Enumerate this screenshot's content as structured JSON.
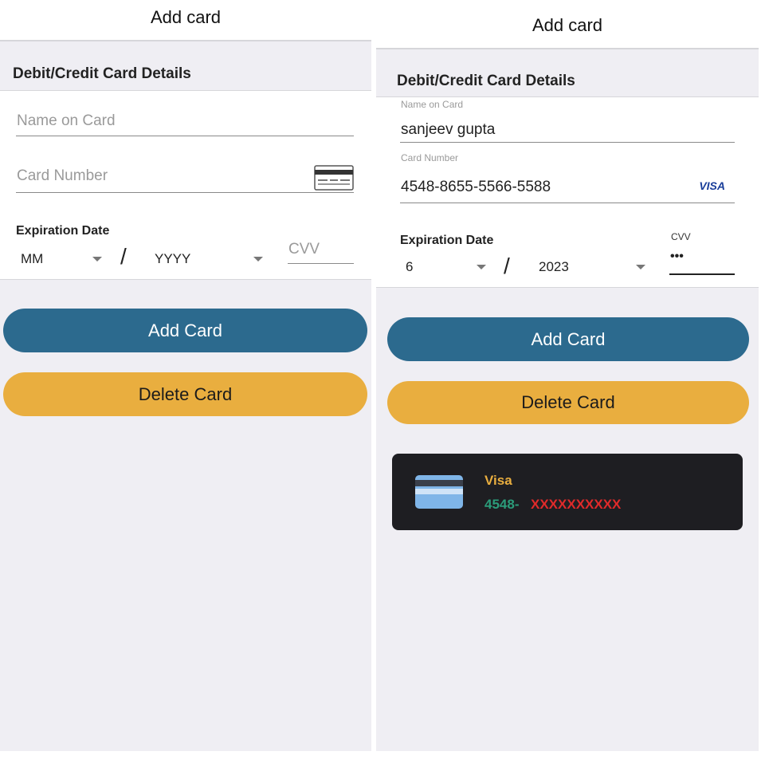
{
  "left": {
    "header": {
      "title": "Add card"
    },
    "section_title": "Debit/Credit Card Details",
    "form": {
      "name_placeholder": "Name on Card",
      "number_placeholder": "Card Number",
      "expiration_label": "Expiration Date",
      "month_value": "MM",
      "year_value": "YYYY",
      "separator": "/",
      "cvv_placeholder": "CVV"
    },
    "buttons": {
      "add_label": "Add Card",
      "delete_label": "Delete Card"
    },
    "icons": {
      "card_icon": "generic-card-icon"
    }
  },
  "right": {
    "header": {
      "title": "Add card"
    },
    "section_title": "Debit/Credit Card Details",
    "form": {
      "name_label": "Name on Card",
      "name_value": "sanjeev gupta",
      "number_label": "Card Number",
      "number_value": "4548-8655-5566-5588",
      "brand_badge": "VISA",
      "expiration_label": "Expiration Date",
      "month_value": "6",
      "year_value": "2023",
      "separator": "/",
      "cvv_label": "CVV",
      "cvv_value": "•••"
    },
    "buttons": {
      "add_label": "Add Card",
      "delete_label": "Delete Card"
    },
    "saved_card": {
      "brand": "Visa",
      "number_first": "4548-",
      "number_masked": "XXXXXXXXXX",
      "icon": "credit-card-icon"
    }
  },
  "colors": {
    "background": "#efeef3",
    "primary_button": "#2c6a8e",
    "secondary_button": "#e9ae3f",
    "card_bg": "#1e1e22",
    "card_brand_text": "#e9ae3f",
    "card_number_text": "#2b9c7a",
    "card_mask_text": "#e02a2a",
    "visa_blue": "#1a3e9a"
  }
}
